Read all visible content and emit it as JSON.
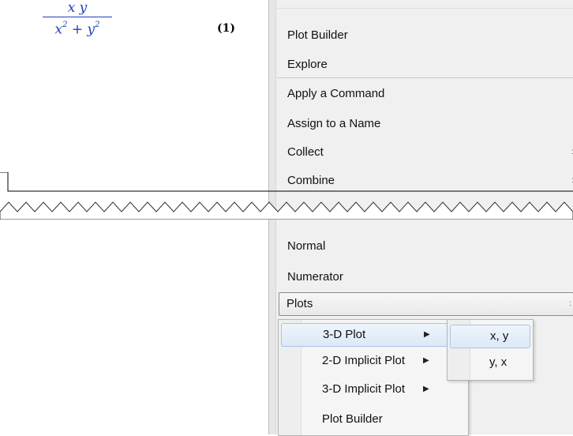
{
  "expression": {
    "numerator": "x y",
    "denominator_base1": "x",
    "exp1": "2",
    "plus": "+",
    "denominator_base2": "y",
    "exp2": "2",
    "label": "(1)"
  },
  "menu": {
    "items_top": [
      "Plot Builder",
      "Explore",
      "Apply a Command",
      "Assign to a Name",
      "Collect",
      "Combine"
    ],
    "items_bottom": [
      "Normal",
      "Numerator",
      "Plots"
    ],
    "submenu_arrow_glyph": ":"
  },
  "submenu": {
    "items": [
      "3-D Plot",
      "2-D Implicit Plot",
      "3-D Implicit Plot",
      "Plot Builder"
    ],
    "arrow_glyph": "▶"
  },
  "submenu2": {
    "items": [
      "x, y",
      "y, x"
    ]
  }
}
